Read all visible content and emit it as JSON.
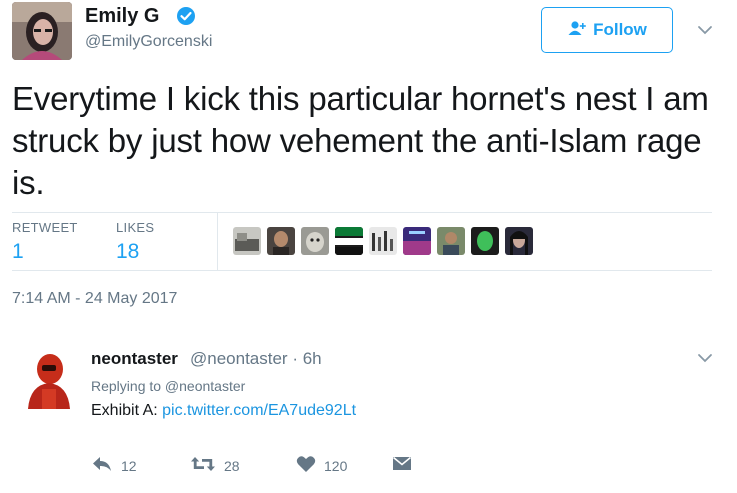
{
  "tweet": {
    "author_name": "Emily G",
    "author_handle": "@EmilyGorcenski",
    "follow_label": "Follow",
    "text": "Everytime I kick this particular hornet's nest I am struck by just how vehement the anti-Islam rage is.",
    "retweet_label": "RETWEET",
    "retweet_count": "1",
    "likes_label": "LIKES",
    "likes_count": "18",
    "timestamp": "7:14 AM - 24 May 2017",
    "liker_avatars": 9
  },
  "reply": {
    "author_name": "neontaster",
    "author_handle_time": "@neontaster · 6h",
    "replying_to": "Replying to @neontaster",
    "text_prefix": "Exhibit A: ",
    "link": "pic.twitter.com/EA7ude92Lt",
    "reply_count": "12",
    "retweet_count": "28",
    "like_count": "120"
  },
  "colors": {
    "accent": "#1da1f2",
    "secondary_text": "#657786",
    "divider": "#e1e8ed"
  },
  "icons": [
    "verified-badge-icon",
    "add-user-icon",
    "chevron-down-icon",
    "reply-icon",
    "retweet-icon",
    "heart-icon",
    "direct-message-icon"
  ]
}
